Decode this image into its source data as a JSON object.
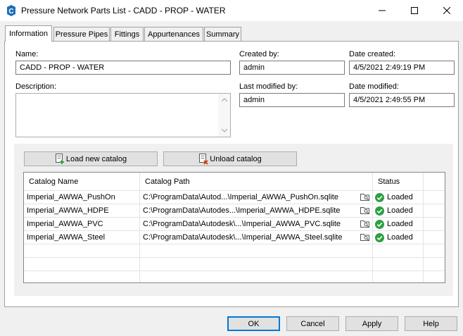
{
  "window": {
    "title": "Pressure Network Parts List - CADD - PROP - WATER"
  },
  "tabs": [
    {
      "label": "Information",
      "active": true
    },
    {
      "label": "Pressure Pipes",
      "active": false
    },
    {
      "label": "Fittings",
      "active": false
    },
    {
      "label": "Appurtenances",
      "active": false
    },
    {
      "label": "Summary",
      "active": false
    }
  ],
  "info": {
    "name_label": "Name:",
    "name_value": "CADD - PROP - WATER",
    "description_label": "Description:",
    "description_value": "",
    "created_by_label": "Created by:",
    "created_by_value": "admin",
    "date_created_label": "Date created:",
    "date_created_value": "4/5/2021 2:49:19 PM",
    "last_modified_by_label": "Last modified by:",
    "last_modified_by_value": "admin",
    "date_modified_label": "Date modified:",
    "date_modified_value": "4/5/2021 2:49:55 PM"
  },
  "catalog": {
    "load_button": "Load new catalog",
    "unload_button": "Unload catalog",
    "columns": [
      "Catalog Name",
      "Catalog Path",
      "Status"
    ],
    "rows": [
      {
        "name": "Imperial_AWWA_PushOn",
        "path": "C:\\ProgramData\\Autod...\\Imperial_AWWA_PushOn.sqlite",
        "status": "Loaded"
      },
      {
        "name": "Imperial_AWWA_HDPE",
        "path": "C:\\ProgramData\\Autodes...\\Imperial_AWWA_HDPE.sqlite",
        "status": "Loaded"
      },
      {
        "name": "Imperial_AWWA_PVC",
        "path": "C:\\ProgramData\\Autodesk\\...\\Imperial_AWWA_PVC.sqlite",
        "status": "Loaded"
      },
      {
        "name": "Imperial_AWWA_Steel",
        "path": "C:\\ProgramData\\Autodesk\\...\\Imperial_AWWA_Steel.sqlite",
        "status": "Loaded"
      }
    ],
    "status_color": "#2ea043"
  },
  "dialog_buttons": {
    "ok": "OK",
    "cancel": "Cancel",
    "apply": "Apply",
    "help": "Help"
  },
  "icons": {
    "app": "civil3d-c-icon",
    "minimize": "minimize-icon",
    "maximize": "maximize-icon",
    "close": "close-icon",
    "load": "load-catalog-icon",
    "unload": "unload-catalog-icon",
    "browse": "browse-folder-icon",
    "status": "check-circle-icon"
  }
}
